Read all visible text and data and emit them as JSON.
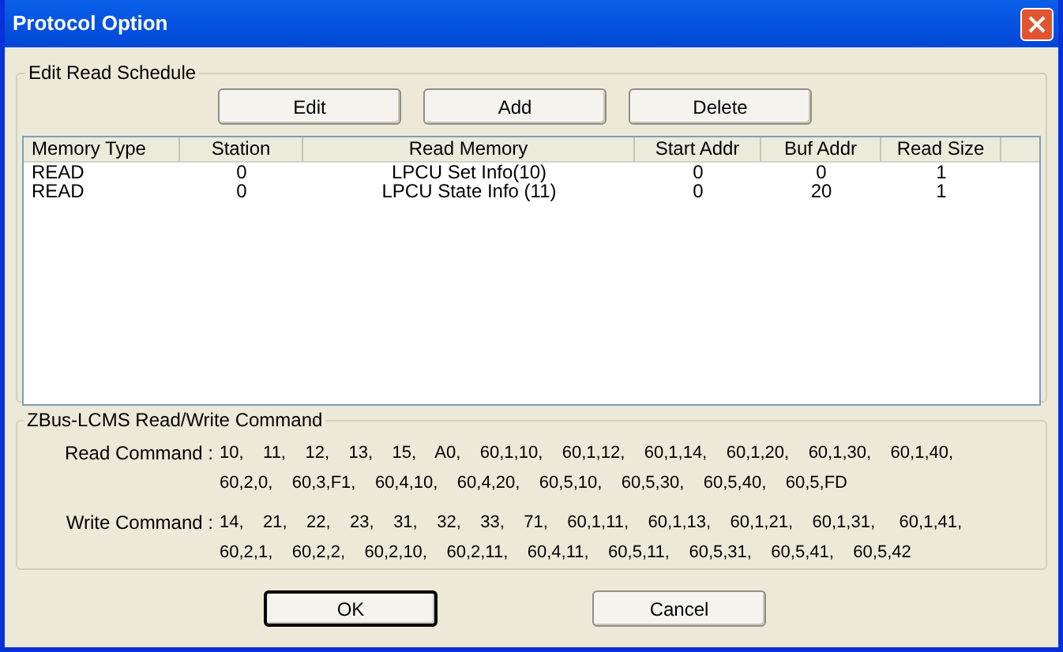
{
  "window": {
    "title": "Protocol Option"
  },
  "schedule": {
    "title": "Edit Read Schedule",
    "buttons": [
      "Edit",
      "Add",
      "Delete"
    ],
    "columns": [
      "Memory Type",
      "Station",
      "Read Memory",
      "Start Addr",
      "Buf Addr",
      "Read Size"
    ],
    "rows": [
      [
        "READ",
        "0",
        "LPCU Set Info(10)",
        "0",
        "0",
        "1"
      ],
      [
        "READ",
        "0",
        "LPCU State Info (11)",
        "0",
        "20",
        "1"
      ]
    ]
  },
  "commands": {
    "title": "ZBus-LCMS Read/Write Command",
    "groups": [
      {
        "label": "Read Command :",
        "lines": [
          "10,    11,    12,    13,    15,    A0,    60,1,10,    60,1,12,    60,1,14,    60,1,20,    60,1,30,    60,1,40,",
          "60,2,0,    60,3,F1,    60,4,10,    60,4,20,    60,5,10,    60,5,30,    60,5,40,    60,5,FD"
        ]
      },
      {
        "label": "Write Command :",
        "lines": [
          "14,    21,    22,    23,    31,    32,    33,    71,    60,1,11,    60,1,13,    60,1,21,    60,1,31,     60,1,41,",
          "60,2,1,    60,2,2,    60,2,10,    60,2,11,    60,4,11,    60,5,11,    60,5,31,    60,5,41,    60,5,42"
        ]
      }
    ]
  },
  "buttons": [
    {
      "label": "OK",
      "default": true
    },
    {
      "label": "Cancel",
      "default": false
    }
  ]
}
